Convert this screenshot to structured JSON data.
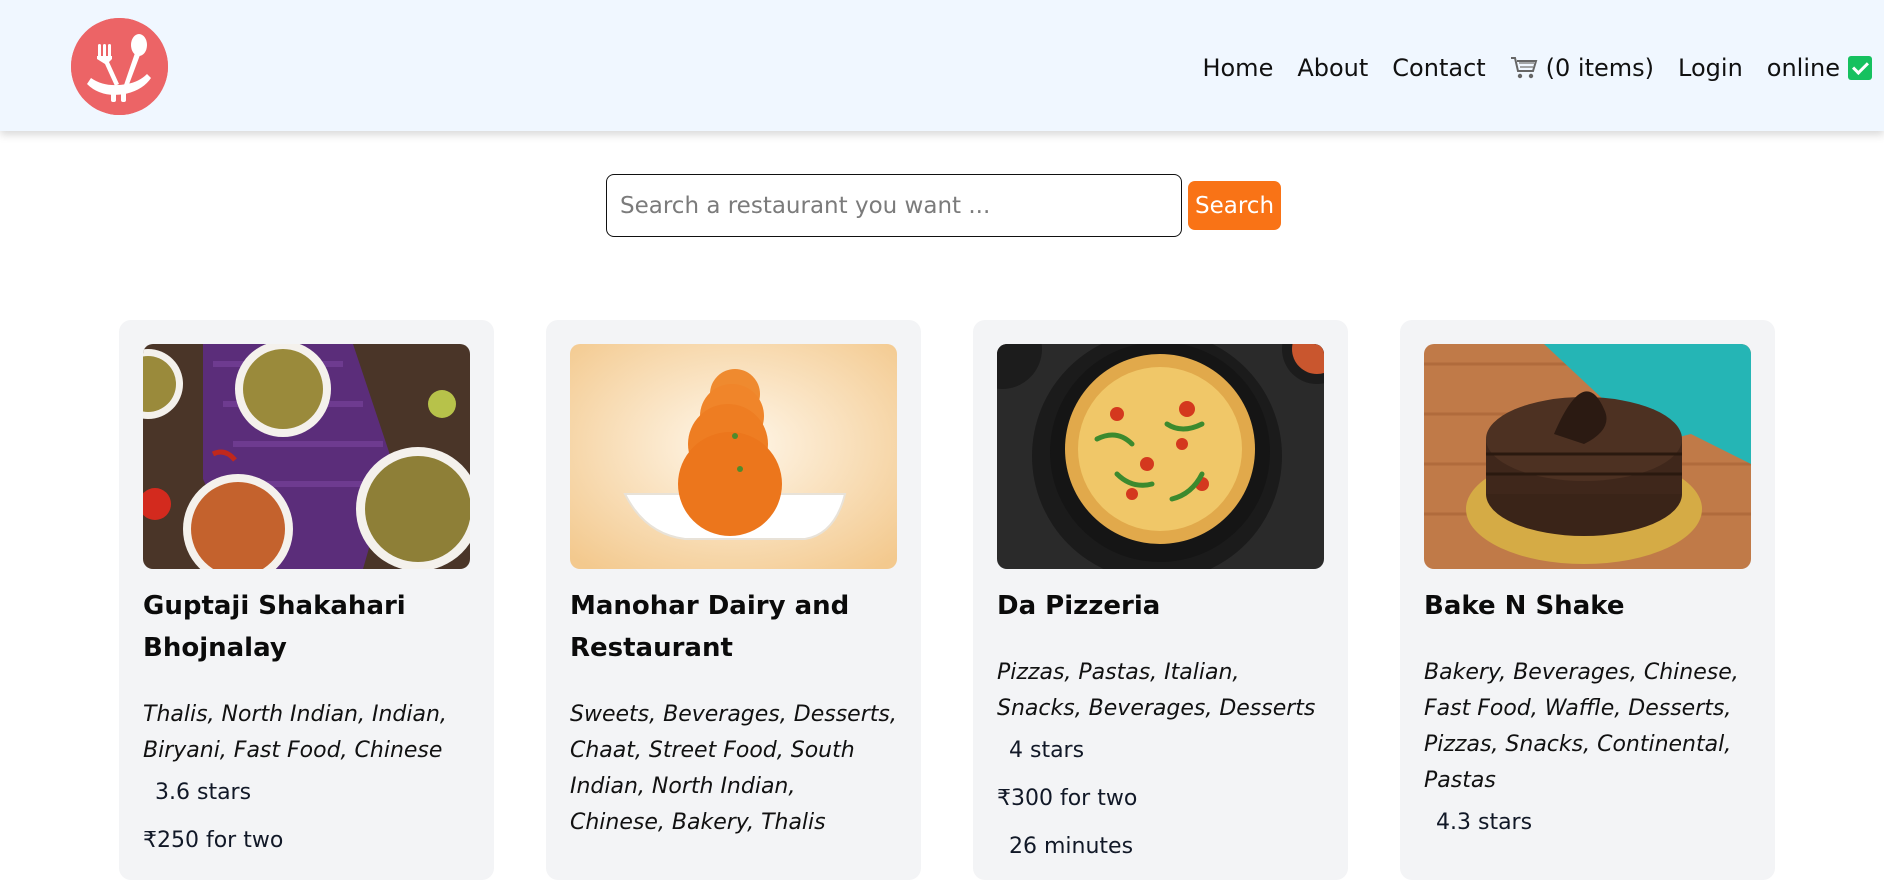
{
  "header": {
    "logo_icon": "fork-spoon-bowl-logo",
    "nav": {
      "home": "Home",
      "about": "About",
      "contact": "Contact",
      "cart_icon": "cart-icon",
      "cart": "(0 items)",
      "login": "Login",
      "status": "online"
    }
  },
  "search": {
    "placeholder": "Search a restaurant you want ...",
    "button": "Search"
  },
  "restaurants": [
    {
      "name": "Guptaji Shakahari Bhojnalay",
      "cuisines": "Thalis, North Indian, Indian, Biryani, Fast Food, Chinese",
      "rating": "3.6 stars",
      "price": "₹250 for two"
    },
    {
      "name": "Manohar Dairy and Restaurant",
      "cuisines": "Sweets, Beverages, Desserts, Chaat, Street Food, South Indian, North Indian, Chinese, Bakery, Thalis"
    },
    {
      "name": "Da Pizzeria",
      "cuisines": "Pizzas, Pastas, Italian, Snacks, Beverages, Desserts",
      "rating": "4 stars",
      "price": "₹300 for two",
      "time": "26 minutes"
    },
    {
      "name": "Bake N Shake",
      "cuisines": "Bakery, Beverages, Chinese, Fast Food, Waffle, Desserts, Pizzas, Snacks, Continental, Pastas",
      "rating": "4.3 stars"
    }
  ],
  "colors": {
    "header_bg": "#f0f7ff",
    "logo_bg": "#ec6466",
    "accent": "#f97316",
    "card_bg": "#f3f4f6",
    "online": "#16c15f"
  }
}
